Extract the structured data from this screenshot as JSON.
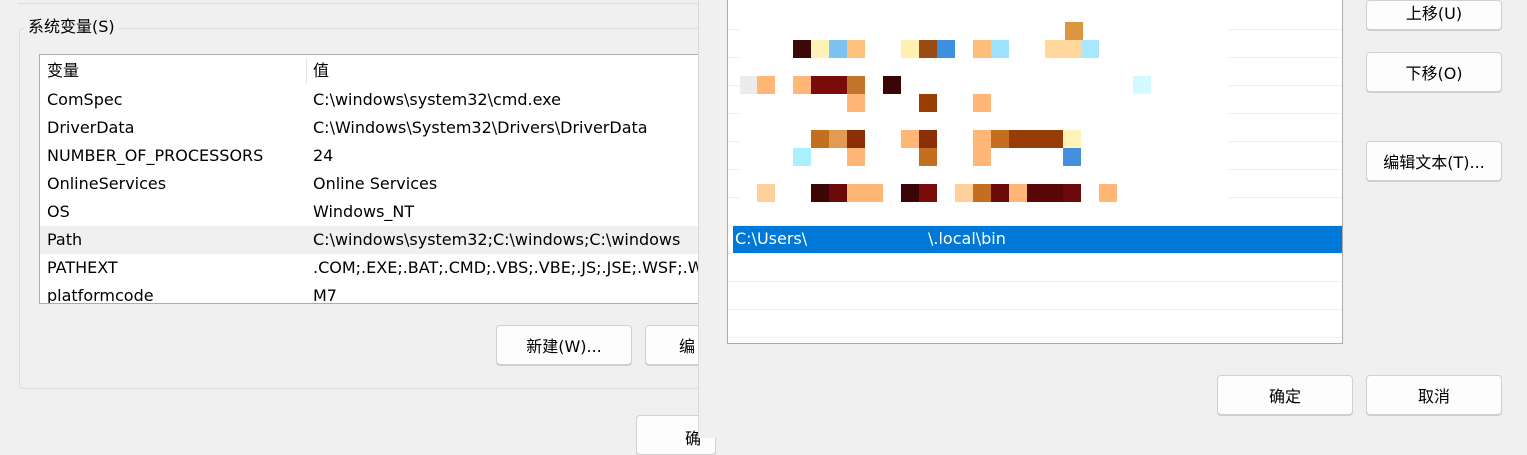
{
  "system_variables": {
    "group_label": "系统变量(S)",
    "columns": [
      "变量",
      "值"
    ],
    "rows": [
      {
        "name": "ComSpec",
        "value": "C:\\windows\\system32\\cmd.exe"
      },
      {
        "name": "DriverData",
        "value": "C:\\Windows\\System32\\Drivers\\DriverData"
      },
      {
        "name": "NUMBER_OF_PROCESSORS",
        "value": "24"
      },
      {
        "name": "OnlineServices",
        "value": "Online Services"
      },
      {
        "name": "OS",
        "value": "Windows_NT"
      },
      {
        "name": "Path",
        "value": "C:\\windows\\system32;C:\\windows;C:\\windows"
      },
      {
        "name": "PATHEXT",
        "value": ".COM;.EXE;.BAT;.CMD;.VBS;.VBE;.JS;.JSE;.WSF;.W"
      },
      {
        "name": "platformcode",
        "value": "M7"
      }
    ],
    "selected_row": "Path",
    "new_button": "新建(W)...",
    "edit_button_partial": "编",
    "ok_button_partial": "确"
  },
  "edit_dialog": {
    "selected_path_prefix": "C:\\Users\\",
    "selected_path_suffix": "\\.local\\bin",
    "move_up_button": "上移(U)",
    "move_down_button": "下移(O)",
    "edit_text_button": "编辑文本(T)...",
    "ok_button": "确定",
    "cancel_button": "取消",
    "selection_color": "#0078d7"
  }
}
